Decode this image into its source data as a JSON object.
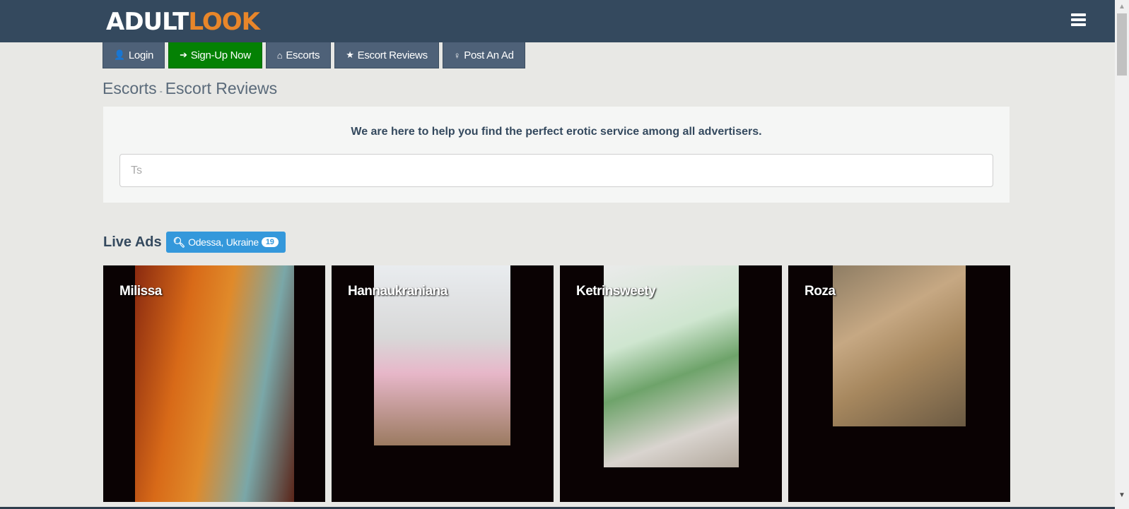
{
  "header": {
    "logo_part1": "ADULT",
    "logo_part2": "LOOK",
    "menu_icon": "hamburger-icon"
  },
  "nav": {
    "buttons": [
      {
        "label": "Login",
        "icon": "user-icon",
        "glyph": "👤"
      },
      {
        "label": "Sign-Up Now",
        "icon": "sign-in-icon",
        "glyph": "➔"
      },
      {
        "label": "Escorts",
        "icon": "home-icon",
        "glyph": "⌂"
      },
      {
        "label": "Escort Reviews",
        "icon": "star-icon",
        "glyph": "★"
      },
      {
        "label": "Post An Ad",
        "icon": "female-icon",
        "glyph": "♀"
      }
    ]
  },
  "breadcrumb": {
    "items": [
      "Escorts",
      "Escort Reviews"
    ],
    "separator": "-"
  },
  "search": {
    "tagline": "We are here to help you find the perfect erotic service among all advertisers.",
    "placeholder": "Ts",
    "value": ""
  },
  "live_ads": {
    "title": "Live Ads",
    "location_label": "Odessa, Ukraine",
    "count": "19",
    "search_glyph": "🔍︎",
    "ads": [
      {
        "name": "Milissa"
      },
      {
        "name": "Hannaukraniana"
      },
      {
        "name": "Ketrinsweety"
      },
      {
        "name": "Roza"
      }
    ]
  },
  "colors": {
    "topbar": "#34495e",
    "logo_accent": "#e8862a",
    "signup_green": "#048104",
    "nav_button": "#4e6178",
    "location_blue": "#3498db"
  }
}
